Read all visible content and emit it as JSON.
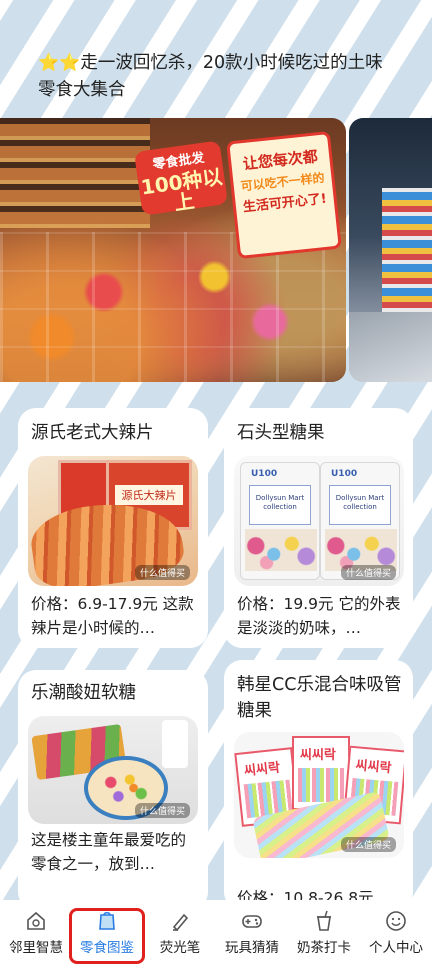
{
  "header": {
    "stars": "⭐⭐",
    "title": "走一波回忆杀，20款小时候吃过的土味零食大集合"
  },
  "banner": {
    "sign_line1": "让您每次都",
    "sign_line2": "可以吃不一样的",
    "sign_line3": "生活可开心了!",
    "badge_small": "零食批发",
    "badge_big": "100种以上"
  },
  "cards": [
    {
      "title": "源氏老式大辣片",
      "image_label": "源氏大辣片",
      "watermark": "什么值得买",
      "desc": "价格：6.9-17.9元 这款辣片是小时候的…"
    },
    {
      "title": "石头型糖果",
      "bag_brand": "U100",
      "bag_name": "Dollysun Mart collection",
      "watermark": "什么值得买",
      "desc": "价格：19.9元 它的外表是淡淡的奶味，…"
    },
    {
      "title": "乐潮酸妞软糖",
      "watermark": "什么值得买",
      "desc": "这是楼主童年最爱吃的零食之一，放到…"
    },
    {
      "title": "韩星CC乐混合味吸管糖果",
      "box_text": "씨씨락",
      "watermark": "什么值得买",
      "desc": "价格：10.8-26.8元"
    }
  ],
  "tabbar": {
    "items": [
      {
        "label": "邻里智慧",
        "icon": "house-bulb-icon"
      },
      {
        "label": "零食图鉴",
        "icon": "snack-bag-icon",
        "active": true
      },
      {
        "label": "荧光笔",
        "icon": "highlighter-icon"
      },
      {
        "label": "玩具猜猜",
        "icon": "gamepad-icon"
      },
      {
        "label": "奶茶打卡",
        "icon": "milk-tea-icon"
      },
      {
        "label": "个人中心",
        "icon": "smiley-icon"
      }
    ],
    "active_color": "#2a7de1",
    "highlight_color": "#e0201c"
  }
}
